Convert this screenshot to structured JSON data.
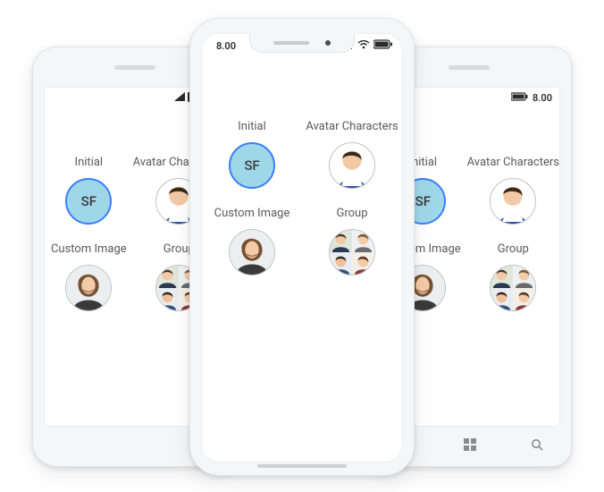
{
  "statusbar": {
    "time": "8.00"
  },
  "labels": {
    "initial": "Initial",
    "avatar_characters": "Avatar Characters",
    "custom_image": "Custom Image",
    "group": "Group"
  },
  "avatars": {
    "initials_text": "SF"
  },
  "colors": {
    "initial_bg": "#9fd7e9",
    "initial_border": "#3b7dff"
  }
}
